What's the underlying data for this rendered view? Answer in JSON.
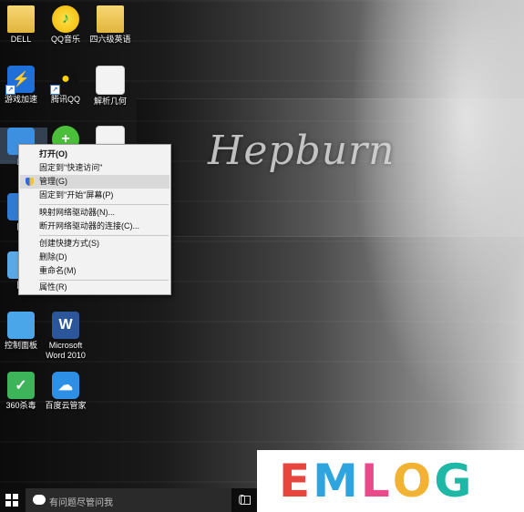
{
  "wallpaper": {
    "signature_text": "Hepburn"
  },
  "desktop_icons": [
    {
      "name": "dell-folder",
      "label": "DELL",
      "glyph": "",
      "kind": "folder"
    },
    {
      "name": "qqmusic",
      "label": "QQ音乐",
      "glyph": "♪",
      "kind": "qqmusic"
    },
    {
      "name": "cet-folder",
      "label": "四六级英语",
      "glyph": "",
      "kind": "folder"
    },
    {
      "name": "game-accel",
      "label": "游戏加速",
      "glyph": "⚡",
      "kind": "game",
      "shortcut": true
    },
    {
      "name": "tencent-qq",
      "label": "腾讯QQ",
      "glyph": "●",
      "kind": "penguin",
      "shortcut": true
    },
    {
      "name": "jiexi-jihe",
      "label": "解析几何",
      "glyph": "",
      "kind": "doc"
    },
    {
      "name": "this-pc",
      "label": "此",
      "glyph": "",
      "kind": "computer"
    },
    {
      "name": "green-app",
      "label": "",
      "glyph": "+",
      "kind": "greenplus"
    },
    {
      "name": "doc-app",
      "label": "",
      "glyph": "",
      "kind": "doc"
    },
    {
      "name": "network",
      "label": "网",
      "glyph": "",
      "kind": "network"
    },
    {
      "name": "recycle-bin",
      "label": "回",
      "glyph": "",
      "kind": "recycle"
    },
    {
      "name": "control-panel",
      "label": "控制面板",
      "glyph": "",
      "kind": "control"
    },
    {
      "name": "word-2010",
      "label": "Microsoft Word 2010",
      "glyph": "W",
      "kind": "word"
    },
    {
      "name": "360-antivirus",
      "label": "360杀毒",
      "glyph": "✓",
      "kind": "shield"
    },
    {
      "name": "baidu-cloud",
      "label": "百度云管家",
      "glyph": "☁",
      "kind": "cloud"
    }
  ],
  "context_menu": {
    "items": [
      {
        "label": "打开(O)",
        "bold": true
      },
      {
        "label": "固定到\"快速访问\""
      },
      {
        "label": "管理(G)",
        "icon": "shield-icon",
        "hover": true
      },
      {
        "label": "固定到\"开始\"屏幕(P)"
      },
      {
        "label": "映射网络驱动器(N)..."
      },
      {
        "label": "断开网络驱动器的连接(C)..."
      },
      {
        "label": "创建快捷方式(S)"
      },
      {
        "label": "删除(D)"
      },
      {
        "label": "重命名(M)"
      },
      {
        "label": "属性(R)"
      }
    ]
  },
  "taskbar": {
    "search_placeholder": "有问题尽管问我"
  },
  "brand": {
    "letters": [
      {
        "char": "E",
        "color": "#e8453c"
      },
      {
        "char": "M",
        "color": "#2fa5e0"
      },
      {
        "char": "L",
        "color": "#e84a8a"
      },
      {
        "char": "O",
        "color": "#f2b233"
      },
      {
        "char": "G",
        "color": "#1fb8a6"
      }
    ]
  }
}
